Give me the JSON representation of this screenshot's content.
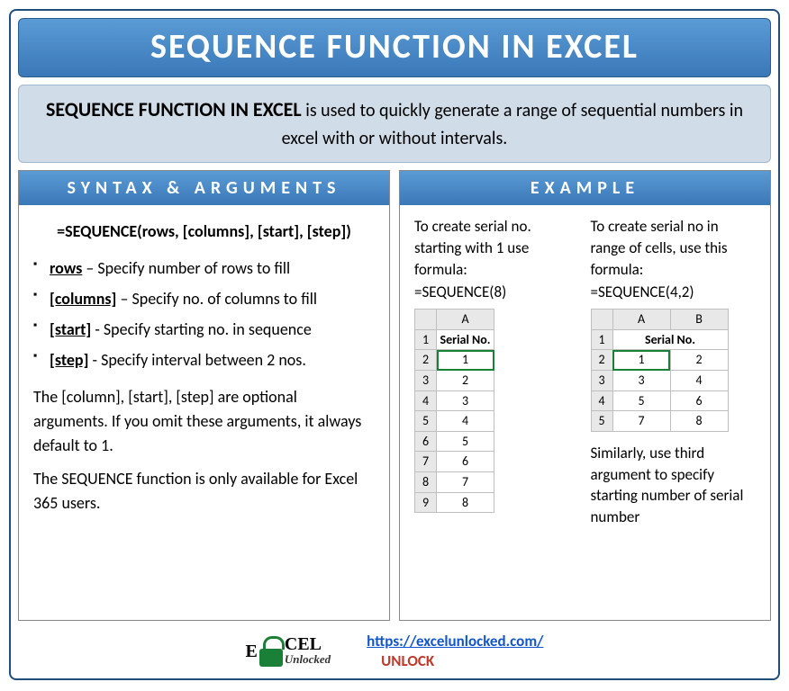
{
  "title": "SEQUENCE FUNCTION IN EXCEL",
  "intro": {
    "lead": "SEQUENCE FUNCTION IN EXCEL",
    "rest": " is used to quickly generate a range of sequential numbers in excel with or without intervals."
  },
  "left": {
    "header": "SYNTAX & ARGUMENTS",
    "formula": "=SEQUENCE(rows, [columns], [start], [step])",
    "args": [
      {
        "name": "rows",
        "desc": " – Specify number of rows to fill"
      },
      {
        "name": "[columns]",
        "desc": " – Specify no. of columns to fill"
      },
      {
        "name": "[start]",
        "desc": " - Specify starting no. in sequence"
      },
      {
        "name": "[step]",
        "desc": " - Specify interval between 2  nos."
      }
    ],
    "note1": "The [column], [start], [step] are optional arguments. If you omit these arguments, it always default to 1.",
    "note2": "The SEQUENCE function is only available for Excel 365 users."
  },
  "right": {
    "header": "EXAMPLE",
    "ex1": {
      "intro": "To create serial no. starting with 1 use formula:",
      "formula": "=SEQUENCE(8)",
      "colLabels": [
        "A"
      ],
      "dataHeader": "Serial No.",
      "rows": [
        [
          "1"
        ],
        [
          "2"
        ],
        [
          "3"
        ],
        [
          "4"
        ],
        [
          "5"
        ],
        [
          "6"
        ],
        [
          "7"
        ],
        [
          "8"
        ]
      ]
    },
    "ex2": {
      "intro": "To create serial no in range of cells, use this formula:",
      "formula": "=SEQUENCE(4,2)",
      "colLabels": [
        "A",
        "B"
      ],
      "dataHeader": "Serial No.",
      "rows": [
        [
          "1",
          "2"
        ],
        [
          "3",
          "4"
        ],
        [
          "5",
          "6"
        ],
        [
          "7",
          "8"
        ]
      ],
      "note": "Similarly, use third argument to specify starting number of serial number"
    }
  },
  "footer": {
    "logoTop": "E   CEL",
    "logoBottom": "Unlocked",
    "url": "https://excelunlocked.com/",
    "unlock": "UNLOCK"
  }
}
